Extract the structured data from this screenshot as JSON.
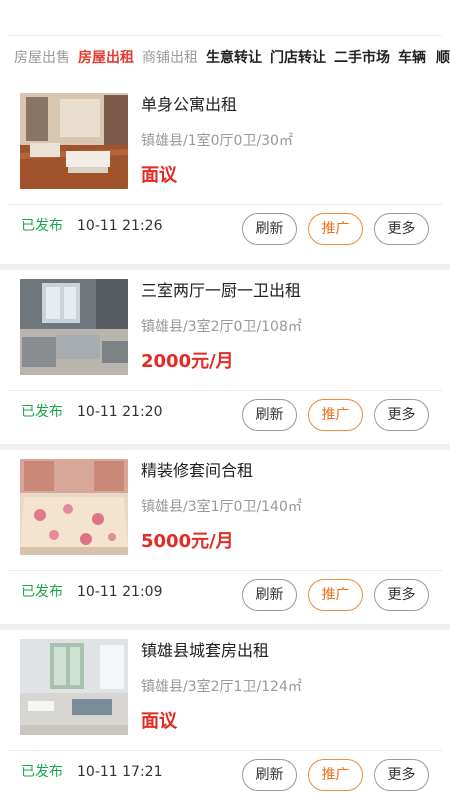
{
  "tabs": [
    {
      "label": "房屋出售",
      "state": "muted"
    },
    {
      "label": "房屋出租",
      "state": "active"
    },
    {
      "label": "商铺出租",
      "state": "muted"
    },
    {
      "label": "生意转让",
      "state": "dark"
    },
    {
      "label": "门店转让",
      "state": "dark"
    },
    {
      "label": "二手市场",
      "state": "dark"
    },
    {
      "label": "车辆",
      "state": "dark"
    },
    {
      "label": "顺",
      "state": "dark"
    }
  ],
  "buttons": {
    "refresh": "刷新",
    "promote": "推广",
    "more": "更多"
  },
  "listings": [
    {
      "title": "单身公寓出租",
      "meta": "镇雄县/1室0厅0卫/30㎡",
      "price": "面议",
      "status": "已发布",
      "time": "10-11 21:26",
      "photo": "living-room-icon"
    },
    {
      "title": "三室两厅一厨一卫出租",
      "meta": "镇雄县/3室2厅0卫/108㎡",
      "price": "2000元/月",
      "status": "已发布",
      "time": "10-11 21:20",
      "photo": "sofa-room-icon"
    },
    {
      "title": "精装修套间合租",
      "meta": "镇雄县/3室1厅0卫/140㎡",
      "price": "5000元/月",
      "status": "已发布",
      "time": "10-11 21:09",
      "photo": "bed-icon"
    },
    {
      "title": "镇雄县城套房出租",
      "meta": "镇雄县/3室2厅1卫/124㎡",
      "price": "面议",
      "status": "已发布",
      "time": "10-11 17:21",
      "photo": "bright-living-room-icon"
    }
  ],
  "colors": {
    "accent": "#e63b32",
    "price": "#e32a24",
    "status": "#1aa64a",
    "promote": "#ef6f1a"
  }
}
